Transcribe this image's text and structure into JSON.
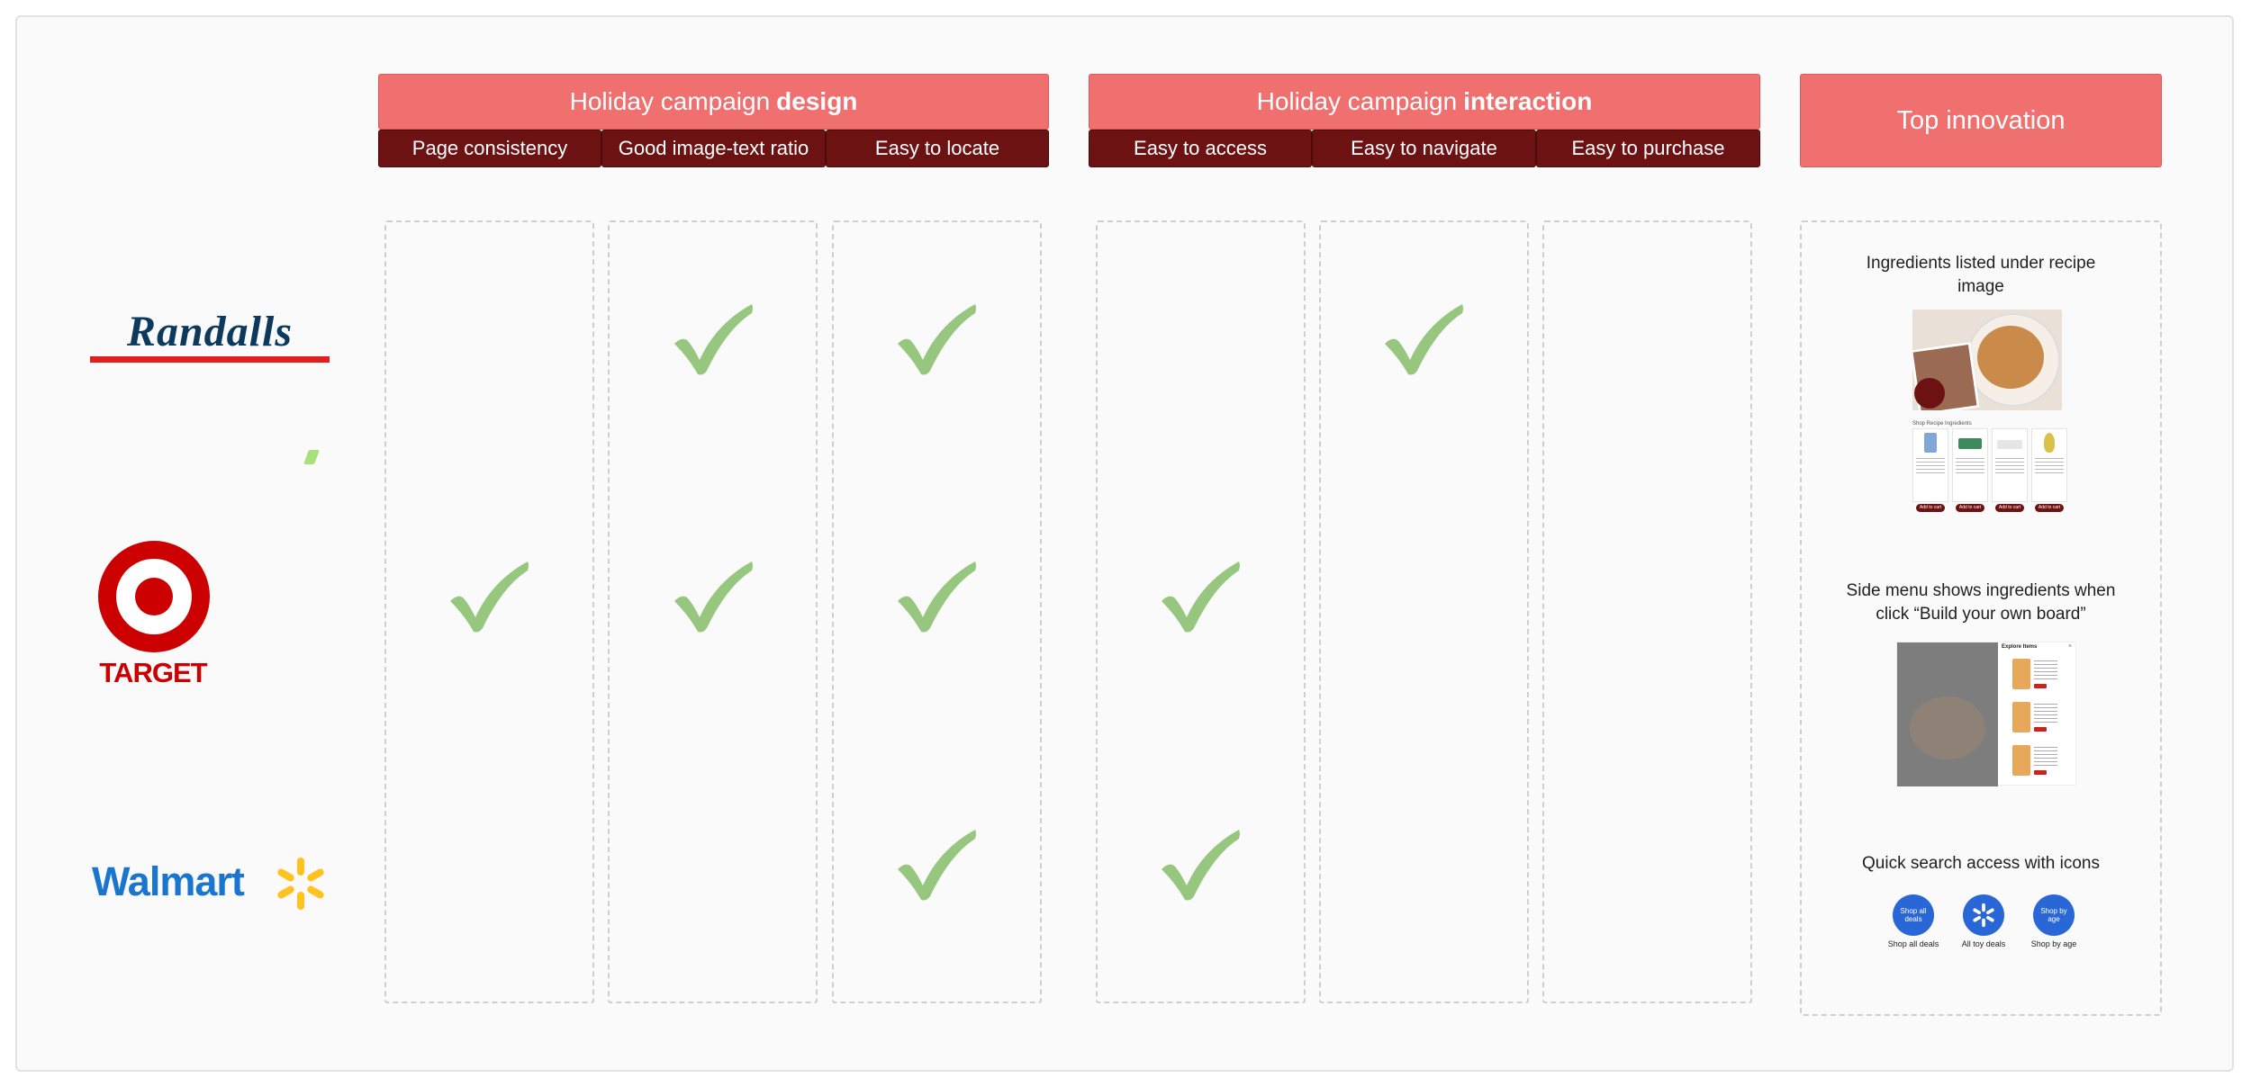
{
  "groups": [
    {
      "title_light": "Holiday campaign",
      "title_bold": "design"
    },
    {
      "title_light": "Holiday campaign",
      "title_bold": "interaction"
    }
  ],
  "top_innovation": {
    "title": "Top innovation"
  },
  "criteria": [
    "Page consistency",
    "Good image-text ratio",
    "Easy to locate",
    "Easy to access",
    "Easy to navigate",
    "Easy to purchase"
  ],
  "brands": [
    {
      "name": "Randalls",
      "logo_text": "Randalls",
      "checks": [
        false,
        true,
        true,
        false,
        true,
        false
      ]
    },
    {
      "name": "Target",
      "logo_text": "TARGET",
      "checks": [
        true,
        true,
        true,
        true,
        false,
        false
      ]
    },
    {
      "name": "Walmart",
      "logo_text": "Walmart",
      "checks": [
        false,
        false,
        true,
        true,
        false,
        false
      ]
    }
  ],
  "innovations": [
    {
      "title": "Ingredients listed under recipe image",
      "subtitle": "Shop Recipe Ingredients",
      "button_label": "Add to cart"
    },
    {
      "title": "Side menu shows ingredients when click “Build your own board”",
      "panel_title": "Explore Items"
    },
    {
      "title": "Quick search access with icons",
      "icons": [
        {
          "inner": "Shop all deals",
          "label": "Shop all deals"
        },
        {
          "inner": "",
          "label": "All toy deals"
        },
        {
          "inner": "Shop by age",
          "label": "Shop by age"
        }
      ]
    }
  ],
  "colors": {
    "header_red": "#f07070",
    "subheader_dark": "#6d1212",
    "check_green": "#97c77f",
    "target_red": "#cc0000",
    "walmart_blue": "#1a75cf",
    "walmart_yellow": "#ffc220",
    "randalls_navy": "#0d3a5c"
  }
}
